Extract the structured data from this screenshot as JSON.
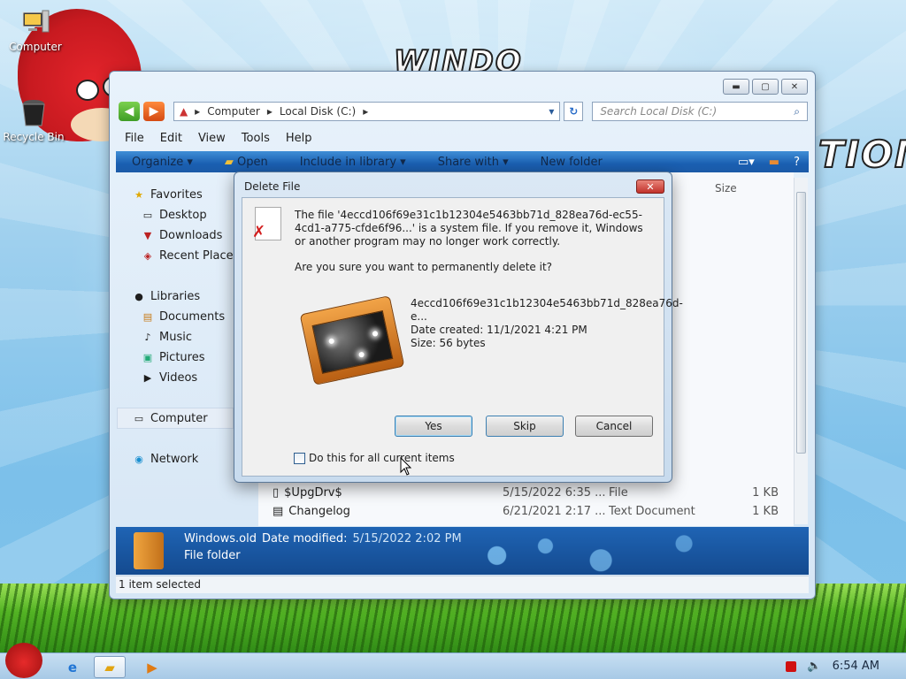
{
  "desktop": {
    "wallpaper_text_top": "WINDO",
    "wallpaper_text_right": "TION",
    "icons": [
      {
        "label": "Computer",
        "icon": "computer-icon"
      },
      {
        "label": "Recycle Bin",
        "icon": "recycle-bin-icon"
      }
    ]
  },
  "explorer": {
    "breadcrumb": [
      "Computer",
      "Local Disk (C:)"
    ],
    "search_placeholder": "Search Local Disk (C:)",
    "menu": [
      "File",
      "Edit",
      "View",
      "Tools",
      "Help"
    ],
    "commands": [
      "Organize ▾",
      "Open",
      "Include in library ▾",
      "Share with ▾",
      "New folder"
    ],
    "column_size": "Size",
    "nav": {
      "favorites": "Favorites",
      "desktop": "Desktop",
      "downloads": "Downloads",
      "recent": "Recent Places",
      "libraries": "Libraries",
      "documents": "Documents",
      "music": "Music",
      "pictures": "Pictures",
      "videos": "Videos",
      "computer": "Computer",
      "network": "Network"
    },
    "files": [
      {
        "name": "$UpgDrv$",
        "date": "5/15/2022 6:35 ...",
        "type": "File",
        "size": "1 KB"
      },
      {
        "name": "Changelog",
        "date": "6/21/2021 2:17 ...",
        "type": "Text Document",
        "size": "1 KB"
      }
    ],
    "details": {
      "name": "Windows.old",
      "date_label": "Date modified:",
      "date_value": "5/15/2022 2:02 PM",
      "kind": "File folder"
    },
    "status": "1 item selected"
  },
  "dialog": {
    "title": "Delete File",
    "message": "The file '4eccd106f69e31c1b12304e5463bb71d_828ea76d-ec55-4cd1-a775-cfde6f96...' is a system file. If you remove it, Windows or another program may no longer work correctly.",
    "question": "Are you sure you want to permanently delete it?",
    "file_name": "4eccd106f69e31c1b12304e5463bb71d_828ea76d-e...",
    "date_created": "Date created: 11/1/2021 4:21 PM",
    "size": "Size: 56 bytes",
    "yes": "Yes",
    "skip": "Skip",
    "cancel": "Cancel",
    "checkbox_label": "Do this for all current items",
    "checkbox_checked": false
  },
  "taskbar": {
    "clock": "6:54 AM"
  }
}
